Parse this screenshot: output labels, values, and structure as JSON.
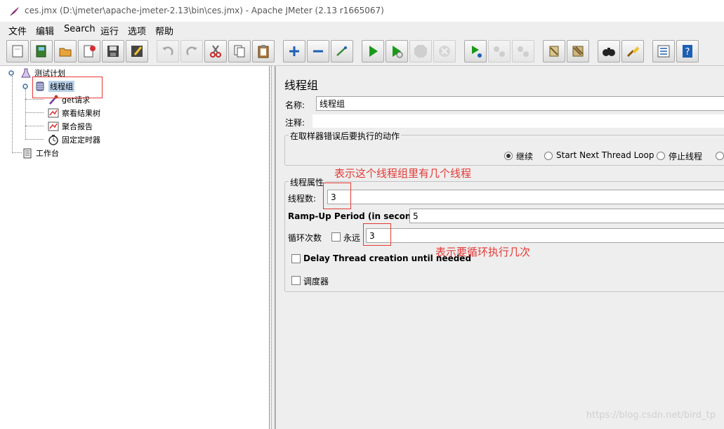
{
  "window": {
    "title": "ces.jmx (D:\\jmeter\\apache-jmeter-2.13\\bin\\ces.jmx) - Apache JMeter (2.13 r1665067)"
  },
  "menu": {
    "items": [
      "文件",
      "编辑",
      "Search",
      "运行",
      "选项",
      "帮助"
    ]
  },
  "tree": {
    "test_plan": "测试计划",
    "thread_group": "线程组",
    "get_request": "get请求",
    "view_results_tree": "察看结果树",
    "aggregate_report": "聚合报告",
    "constant_timer": "固定定时器",
    "workbench": "工作台"
  },
  "panel": {
    "title": "线程组",
    "name_label": "名称:",
    "name_value": "线程组",
    "comment_label": "注释:",
    "comment_value": "",
    "error_action": {
      "title": "在取样器错误后要执行的动作",
      "options": [
        "继续",
        "Start Next Thread Loop",
        "停止线程"
      ],
      "selected": "继续"
    },
    "thread_properties": {
      "title": "线程属性",
      "threads_label": "线程数:",
      "threads_value": "3",
      "rampup_label": "Ramp-Up Period (in seconds):",
      "rampup_value": "5",
      "loop_label": "循环次数",
      "forever_label": "永远",
      "loop_value": "3",
      "delay_label": "Delay Thread creation until needed",
      "scheduler_label": "调度器"
    }
  },
  "annotations": {
    "threads_note": "表示这个线程组里有几个线程",
    "loop_note": "表示要循环执行几次"
  },
  "watermark": "https://blog.csdn.net/bird_tp",
  "colors": {
    "annotation_red": "#e53935",
    "panel_bg": "#eeeeee",
    "play_green": "#1a9a1a"
  }
}
